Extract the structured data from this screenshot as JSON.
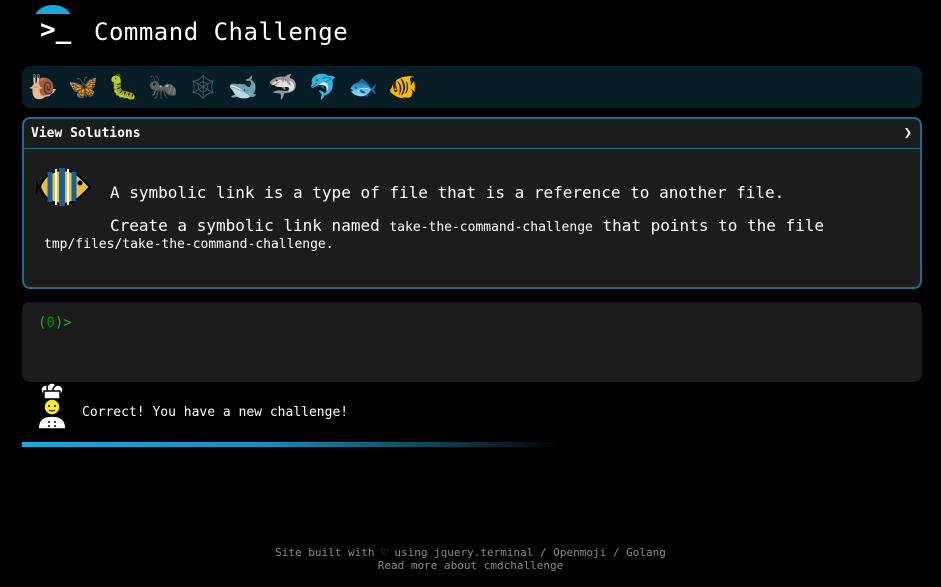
{
  "header": {
    "logo_glyph": ">_",
    "title": "Command Challenge",
    "logo_color": "#18a9dc"
  },
  "levels": [
    {
      "icon": "snail-icon",
      "glyph": "🐌",
      "state": "unlocked"
    },
    {
      "icon": "butterfly-icon",
      "glyph": "🦋",
      "state": "unlocked"
    },
    {
      "icon": "caterpillar-icon",
      "glyph": "🐛",
      "state": "unlocked"
    },
    {
      "icon": "ant-icon",
      "glyph": "🐜",
      "state": "unlocked"
    },
    {
      "icon": "spider-web-icon",
      "glyph": "🕸",
      "state": "locked"
    },
    {
      "icon": "whale-icon",
      "glyph": "🐋",
      "state": "unlocked"
    },
    {
      "icon": "shark-icon",
      "glyph": "🦈",
      "state": "unlocked"
    },
    {
      "icon": "dolphin-icon",
      "glyph": "🐬",
      "state": "unlocked"
    },
    {
      "icon": "fish-icon",
      "glyph": "🐟",
      "state": "unlocked"
    },
    {
      "icon": "tropical-fish-icon",
      "glyph": "🐠",
      "state": "current"
    }
  ],
  "challenge": {
    "solutions_label": "View Solutions",
    "chevron": "❯",
    "icon": "tropical-fish-icon",
    "line1": "A symbolic link is a type of file that is a reference to another file.",
    "line2_prefix": "Create a symbolic link named ",
    "line2_code": "take-the-command-challenge",
    "line2_suffix": " that points to the file",
    "line3_code": "tmp/files/take-the-command-challenge",
    "line3_suffix": "."
  },
  "terminal": {
    "prompt_open": "(",
    "prompt_count": "0",
    "prompt_close": ")>"
  },
  "status": {
    "icon": "chef-icon",
    "message": "Correct! You have a new challenge!",
    "progress_fraction": 0.6
  },
  "footer": {
    "line1_prefix": "Site built with ",
    "heart": "♡",
    "line1_using": " using ",
    "link_jquery": "jquery.terminal",
    "sep1": " / ",
    "link_openmoji": "Openmoji",
    "sep2": " / ",
    "link_golang": "Golang",
    "line2_prefix": "Read more about ",
    "link_about": "cmdchallenge"
  },
  "colors": {
    "accent": "#18a9dc",
    "panel_border": "#1d6f86",
    "prompt_green": "#1ab21a"
  }
}
